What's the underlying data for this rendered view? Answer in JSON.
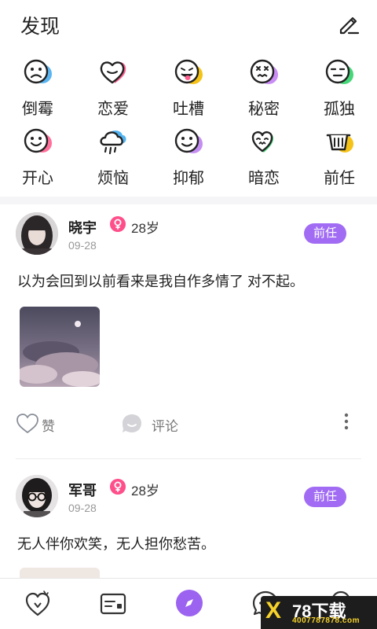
{
  "header": {
    "title": "发现"
  },
  "moods": [
    {
      "label": "倒霉",
      "icon": "sad-face-icon",
      "accent": "#5ab4f0"
    },
    {
      "label": "恋爱",
      "icon": "heart-face-icon",
      "accent": "#ff5f8f"
    },
    {
      "label": "吐槽",
      "icon": "tongue-face-icon",
      "accent": "#f5c318"
    },
    {
      "label": "秘密",
      "icon": "dizzy-face-icon",
      "accent": "#c98df5"
    },
    {
      "label": "孤独",
      "icon": "lonely-face-icon",
      "accent": "#47d77a"
    },
    {
      "label": "开心",
      "icon": "happy-face-icon",
      "accent": "#ff6f9a"
    },
    {
      "label": "烦恼",
      "icon": "rain-cloud-icon",
      "accent": "#52b3f1"
    },
    {
      "label": "抑郁",
      "icon": "depressed-face-icon",
      "accent": "#c48ef3"
    },
    {
      "label": "暗恋",
      "icon": "shy-heart-icon",
      "accent": "#44d47c"
    },
    {
      "label": "前任",
      "icon": "basket-icon",
      "accent": "#f5c318"
    }
  ],
  "posts": [
    {
      "user": "晓宇",
      "age": "28岁",
      "date": "09-28",
      "tag": "前任",
      "content": "以为会回到以前看来是我自作多情了 对不起。",
      "has_photo": true
    },
    {
      "user": "军哥",
      "age": "28岁",
      "date": "09-28",
      "tag": "前任",
      "content": "无人伴你欢笑，无人担你愁苦。",
      "has_photo": false
    }
  ],
  "actions": {
    "like_label": "赞",
    "comment_label": "评论"
  },
  "colors": {
    "accent": "#a16cf3",
    "gender_female": "#ff4f8b"
  },
  "watermark": {
    "brand": "78下载",
    "url": "40077878​78.com"
  }
}
